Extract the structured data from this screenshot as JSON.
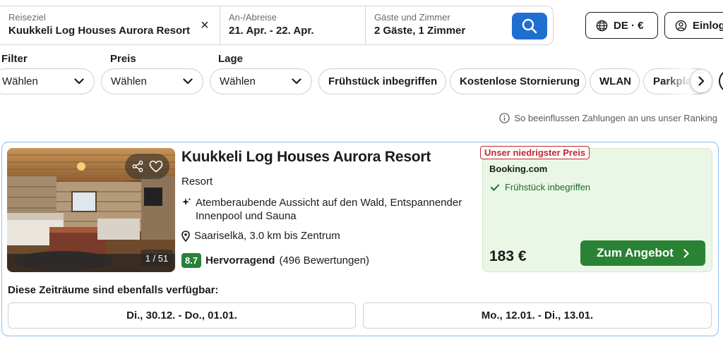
{
  "search": {
    "destination_label": "Reiseziel",
    "destination_value": "Kuukkeli Log Houses Aurora Resort",
    "dates_label": "An-/Abreise",
    "dates_value": "21. Apr. - 22. Apr.",
    "guests_label": "Gäste und Zimmer",
    "guests_value": "2 Gäste, 1 Zimmer",
    "clear_glyph": "×"
  },
  "header": {
    "language_currency": "DE · €",
    "login_label": "Einlog"
  },
  "filters": {
    "dropdowns": [
      {
        "label": "Filter",
        "value": "Wählen"
      },
      {
        "label": "Preis",
        "value": "Wählen"
      },
      {
        "label": "Lage",
        "value": "Wählen"
      }
    ],
    "chips": [
      "Frühstück inbegriffen",
      "Kostenlose Stornierung",
      "WLAN",
      "Parkplatz"
    ]
  },
  "ranking_note": "So beeinflussen Zahlungen an uns unser Ranking",
  "result": {
    "name": "Kuukkeli Log Houses Aurora Resort",
    "type": "Resort",
    "feature": "Atemberaubende Aussicht auf den Wald, Entspannender Innenpool und Sauna",
    "location": "Saariselkä, 3.0 km bis Zentrum",
    "score": "8.7",
    "rating_word": "Hervorragend",
    "reviews": "(496 Bewertungen)",
    "photo_counter": "1 / 51",
    "deal": {
      "badge": "Unser niedrigster Preis",
      "provider": "Booking.com",
      "perk": "Frühstück inbegriffen",
      "price": "183 €",
      "cta": "Zum Angebot"
    },
    "alternatives_heading": "Diese Zeiträume sind ebenfalls verfügbar:",
    "alternatives": [
      "Di., 30.12. - Do., 01.01.",
      "Mo., 12.01. - Di., 13.01."
    ]
  },
  "colors": {
    "primary_blue": "#1f6fd1",
    "deal_green": "#2a8234",
    "score_green": "#28803a",
    "badge_red": "#c3262f",
    "card_border": "#8fbef0",
    "deal_bg": "#eaf7e7"
  }
}
